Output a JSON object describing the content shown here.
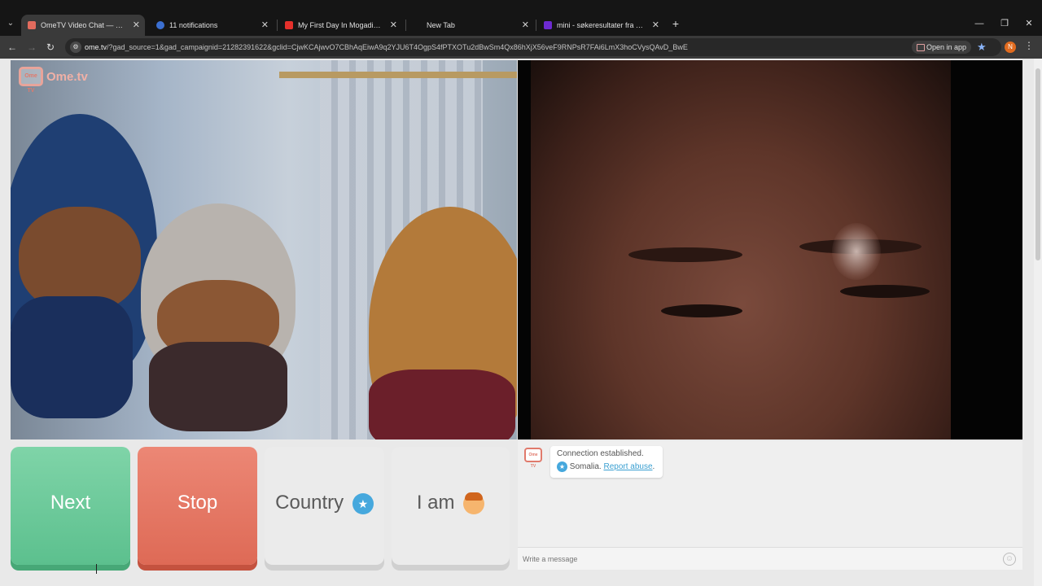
{
  "browser": {
    "tabs": [
      {
        "title": "OmeTV Video Chat — Ome",
        "active": true,
        "favicon_color": "#e26b5d"
      },
      {
        "title": "11 notifications",
        "active": false,
        "favicon_color": "#3b6fd1"
      },
      {
        "title": "My First Day In Mogadishu And",
        "active": false,
        "favicon_color": "#e5302b"
      },
      {
        "title": "New Tab",
        "active": false,
        "favicon_color": "#151515"
      },
      {
        "title": "mini - søkeresultater fra Yahoo",
        "active": false,
        "favicon_color": "#6d2ad1"
      }
    ],
    "url_host": "ome.tv",
    "url_rest": "/?gad_source=1&gad_campaignid=21282391622&gclid=CjwKCAjwvO7CBhAqEiwA9q2YJU6T4OgpS4fPTXOTu2dBwSm4Qx86hXjX56veF9RNPsR7FAi6LmX3hoCVysQAvD_BwE",
    "open_in_app_label": "Open in app",
    "profile_initial": "N"
  },
  "page": {
    "logo_text": "Ome.tv",
    "logo_badge": "Ome TV",
    "buttons": {
      "next": "Next",
      "stop": "Stop",
      "country": "Country",
      "iam": "I am"
    },
    "chat": {
      "message_line1": "Connection established.",
      "country": "Somalia.",
      "report_link": "Report abuse",
      "report_suffix": ".",
      "input_placeholder": "Write a message"
    }
  }
}
